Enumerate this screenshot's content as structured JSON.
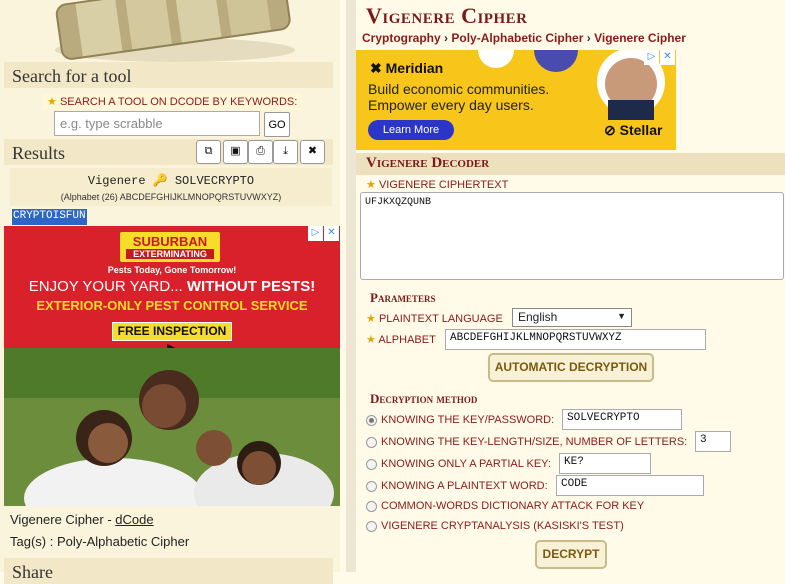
{
  "sidebar": {
    "search_heading": "Search for a tool",
    "search_hint": "SEARCH A TOOL ON DCODE BY KEYWORDS:",
    "search_placeholder": "e.g. type scrabble",
    "go_label": "GO",
    "results_heading": "Results",
    "result_line": "Vigenere 🔑 SOLVECRYPTO",
    "alphabet_line": "(Alphabet (26) ABCDEFGHIJKLMNOPQRSTUVWXYZ)",
    "plaintext_output": "CRYPTOISFUN",
    "caption_prefix": "Vigenere Cipher - ",
    "caption_link": "dCode",
    "tags_line": "Tag(s) : Poly-Alphabetic Cipher",
    "share_heading": "Share"
  },
  "ad_left": {
    "logo_line1": "SUBURBAN",
    "logo_line2": "EXTERMINATING",
    "tagline": "Pests Today, Gone Tomorrow!",
    "headline_part1": "ENJOY YOUR YARD... ",
    "headline_part2": "WITHOUT PESTS!",
    "subheadline": "EXTERIOR-ONLY PEST CONTROL SERVICE",
    "cta": "FREE INSPECTION ▶"
  },
  "main": {
    "title": "Vigenere Cipher",
    "breadcrumb": [
      "Cryptography",
      "Poly-Alphabetic Cipher",
      "Vigenere Cipher"
    ],
    "decoder_heading": "Vigenere Decoder",
    "ciphertext_label": "VIGENERE CIPHERTEXT",
    "ciphertext_value": "UFJKXQZQUNB",
    "parameters_heading": "Parameters",
    "language_label": "PLAINTEXT LANGUAGE",
    "language_value": "English",
    "alphabet_label": "ALPHABET",
    "alphabet_value": "ABCDEFGHIJKLMNOPQRSTUVWXYZ",
    "auto_button": "AUTOMATIC DECRYPTION",
    "method_heading": "Decryption method",
    "options": [
      {
        "label": "KNOWING THE KEY/PASSWORD:",
        "value": "SOLVECRYPTO",
        "checked": true
      },
      {
        "label": "KNOWING THE KEY-LENGTH/SIZE, NUMBER OF LETTERS:",
        "value": "3",
        "checked": false
      },
      {
        "label": "KNOWING ONLY A PARTIAL KEY:",
        "value": "KE?",
        "checked": false
      },
      {
        "label": "KNOWING A PLAINTEXT WORD:",
        "value": "CODE",
        "checked": false
      },
      {
        "label": "COMMON-WORDS DICTIONARY ATTACK FOR KEY",
        "value": null,
        "checked": false
      },
      {
        "label": "VIGENERE CRYPTANALYSIS (KASISKI'S TEST)",
        "value": null,
        "checked": false
      }
    ],
    "decrypt_button": "DECRYPT"
  },
  "ad_right": {
    "brand": "Meridian",
    "body": "Build economic communities. Empower every day users.",
    "cta": "Learn More",
    "sponsor": "Stellar"
  },
  "icons": {
    "tools": [
      "copy-icon",
      "screenshot-icon",
      "print-icon",
      "download-icon",
      "close-icon"
    ]
  }
}
